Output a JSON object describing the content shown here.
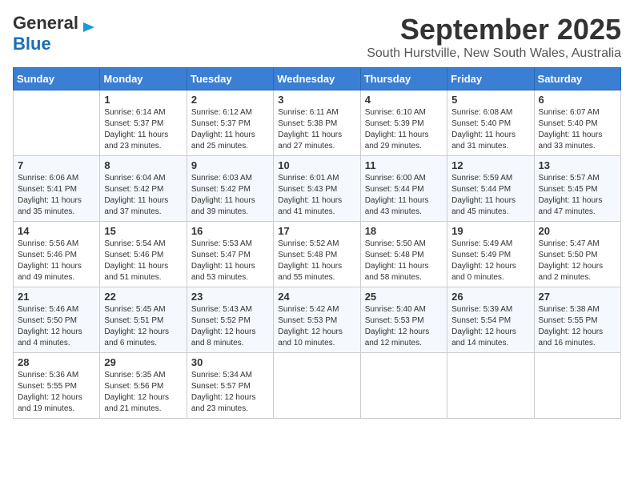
{
  "header": {
    "logo_general": "General",
    "logo_blue": "Blue",
    "month": "September 2025",
    "location": "South Hurstville, New South Wales, Australia"
  },
  "weekdays": [
    "Sunday",
    "Monday",
    "Tuesday",
    "Wednesday",
    "Thursday",
    "Friday",
    "Saturday"
  ],
  "weeks": [
    [
      {
        "day": "",
        "content": ""
      },
      {
        "day": "1",
        "content": "Sunrise: 6:14 AM\nSunset: 5:37 PM\nDaylight: 11 hours\nand 23 minutes."
      },
      {
        "day": "2",
        "content": "Sunrise: 6:12 AM\nSunset: 5:37 PM\nDaylight: 11 hours\nand 25 minutes."
      },
      {
        "day": "3",
        "content": "Sunrise: 6:11 AM\nSunset: 5:38 PM\nDaylight: 11 hours\nand 27 minutes."
      },
      {
        "day": "4",
        "content": "Sunrise: 6:10 AM\nSunset: 5:39 PM\nDaylight: 11 hours\nand 29 minutes."
      },
      {
        "day": "5",
        "content": "Sunrise: 6:08 AM\nSunset: 5:40 PM\nDaylight: 11 hours\nand 31 minutes."
      },
      {
        "day": "6",
        "content": "Sunrise: 6:07 AM\nSunset: 5:40 PM\nDaylight: 11 hours\nand 33 minutes."
      }
    ],
    [
      {
        "day": "7",
        "content": "Sunrise: 6:06 AM\nSunset: 5:41 PM\nDaylight: 11 hours\nand 35 minutes."
      },
      {
        "day": "8",
        "content": "Sunrise: 6:04 AM\nSunset: 5:42 PM\nDaylight: 11 hours\nand 37 minutes."
      },
      {
        "day": "9",
        "content": "Sunrise: 6:03 AM\nSunset: 5:42 PM\nDaylight: 11 hours\nand 39 minutes."
      },
      {
        "day": "10",
        "content": "Sunrise: 6:01 AM\nSunset: 5:43 PM\nDaylight: 11 hours\nand 41 minutes."
      },
      {
        "day": "11",
        "content": "Sunrise: 6:00 AM\nSunset: 5:44 PM\nDaylight: 11 hours\nand 43 minutes."
      },
      {
        "day": "12",
        "content": "Sunrise: 5:59 AM\nSunset: 5:44 PM\nDaylight: 11 hours\nand 45 minutes."
      },
      {
        "day": "13",
        "content": "Sunrise: 5:57 AM\nSunset: 5:45 PM\nDaylight: 11 hours\nand 47 minutes."
      }
    ],
    [
      {
        "day": "14",
        "content": "Sunrise: 5:56 AM\nSunset: 5:46 PM\nDaylight: 11 hours\nand 49 minutes."
      },
      {
        "day": "15",
        "content": "Sunrise: 5:54 AM\nSunset: 5:46 PM\nDaylight: 11 hours\nand 51 minutes."
      },
      {
        "day": "16",
        "content": "Sunrise: 5:53 AM\nSunset: 5:47 PM\nDaylight: 11 hours\nand 53 minutes."
      },
      {
        "day": "17",
        "content": "Sunrise: 5:52 AM\nSunset: 5:48 PM\nDaylight: 11 hours\nand 55 minutes."
      },
      {
        "day": "18",
        "content": "Sunrise: 5:50 AM\nSunset: 5:48 PM\nDaylight: 11 hours\nand 58 minutes."
      },
      {
        "day": "19",
        "content": "Sunrise: 5:49 AM\nSunset: 5:49 PM\nDaylight: 12 hours\nand 0 minutes."
      },
      {
        "day": "20",
        "content": "Sunrise: 5:47 AM\nSunset: 5:50 PM\nDaylight: 12 hours\nand 2 minutes."
      }
    ],
    [
      {
        "day": "21",
        "content": "Sunrise: 5:46 AM\nSunset: 5:50 PM\nDaylight: 12 hours\nand 4 minutes."
      },
      {
        "day": "22",
        "content": "Sunrise: 5:45 AM\nSunset: 5:51 PM\nDaylight: 12 hours\nand 6 minutes."
      },
      {
        "day": "23",
        "content": "Sunrise: 5:43 AM\nSunset: 5:52 PM\nDaylight: 12 hours\nand 8 minutes."
      },
      {
        "day": "24",
        "content": "Sunrise: 5:42 AM\nSunset: 5:53 PM\nDaylight: 12 hours\nand 10 minutes."
      },
      {
        "day": "25",
        "content": "Sunrise: 5:40 AM\nSunset: 5:53 PM\nDaylight: 12 hours\nand 12 minutes."
      },
      {
        "day": "26",
        "content": "Sunrise: 5:39 AM\nSunset: 5:54 PM\nDaylight: 12 hours\nand 14 minutes."
      },
      {
        "day": "27",
        "content": "Sunrise: 5:38 AM\nSunset: 5:55 PM\nDaylight: 12 hours\nand 16 minutes."
      }
    ],
    [
      {
        "day": "28",
        "content": "Sunrise: 5:36 AM\nSunset: 5:55 PM\nDaylight: 12 hours\nand 19 minutes."
      },
      {
        "day": "29",
        "content": "Sunrise: 5:35 AM\nSunset: 5:56 PM\nDaylight: 12 hours\nand 21 minutes."
      },
      {
        "day": "30",
        "content": "Sunrise: 5:34 AM\nSunset: 5:57 PM\nDaylight: 12 hours\nand 23 minutes."
      },
      {
        "day": "",
        "content": ""
      },
      {
        "day": "",
        "content": ""
      },
      {
        "day": "",
        "content": ""
      },
      {
        "day": "",
        "content": ""
      }
    ]
  ]
}
